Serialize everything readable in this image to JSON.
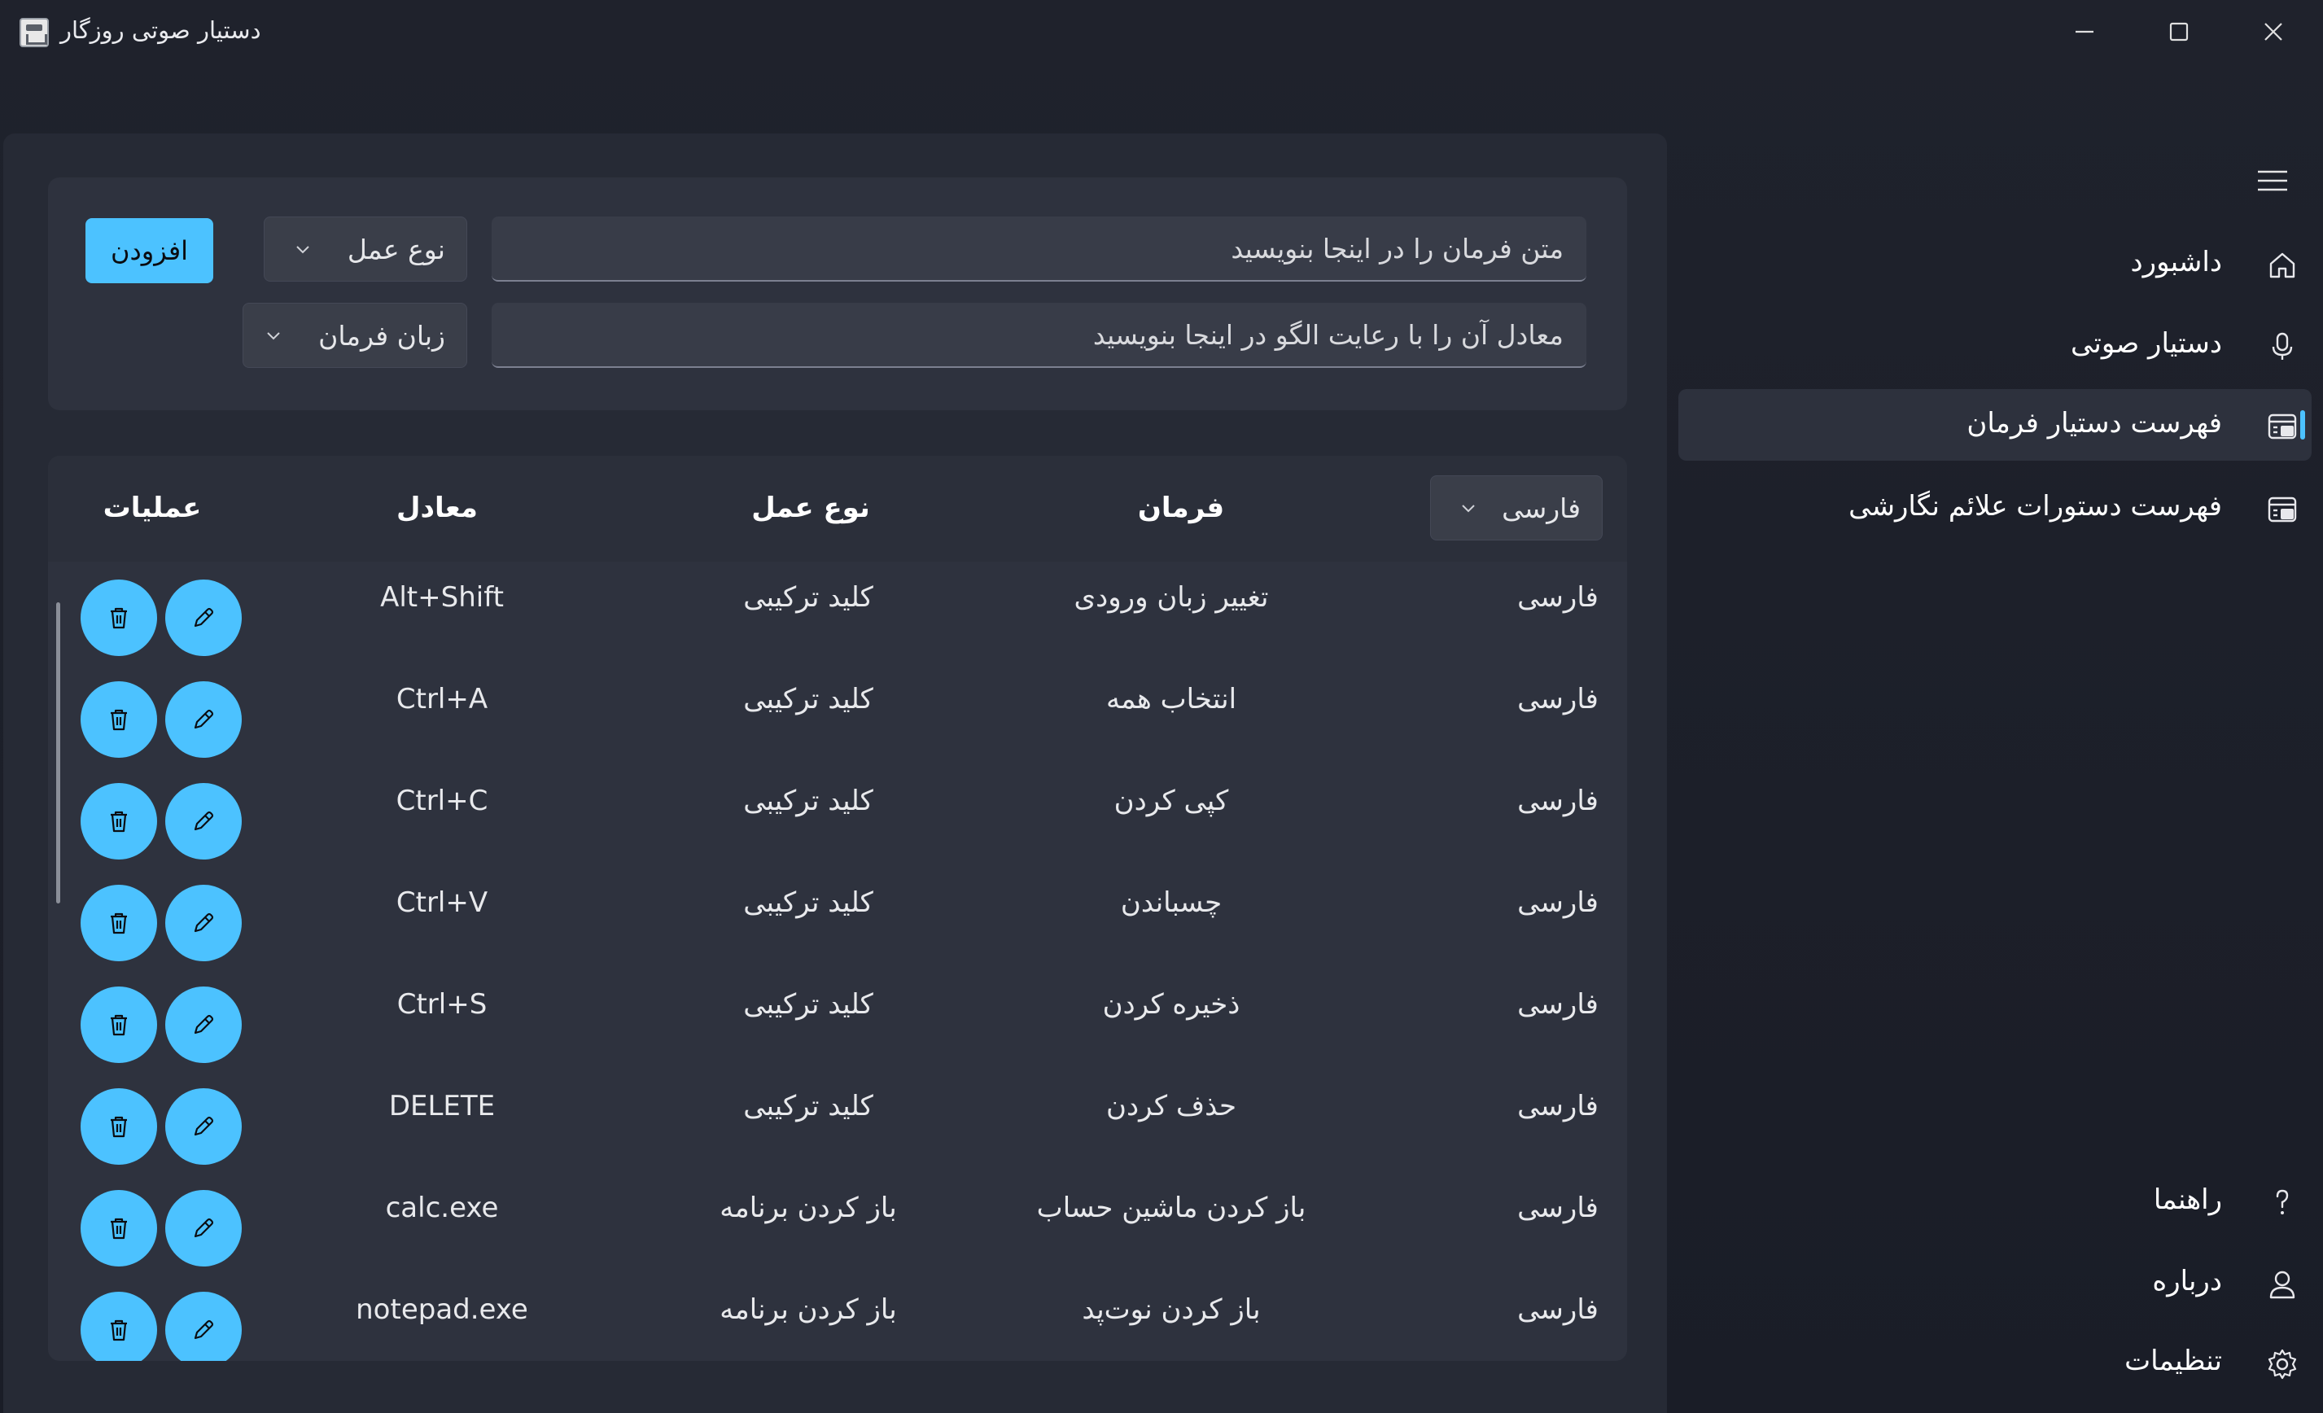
{
  "window": {
    "title": "دستیار صوتی روزگار",
    "accent": "#4cc2ff",
    "icons": {
      "minimize": "minimize-icon",
      "maximize": "maximize-icon",
      "close": "close-icon"
    }
  },
  "form": {
    "command_placeholder": "متن فرمان را در اینجا بنویسید",
    "equivalent_placeholder": "معادل آن را با رعایت الگو در اینجا بنویسید",
    "action_type_label": "نوع عمل",
    "command_language_label": "زبان فرمان",
    "add_label": "افزودن"
  },
  "table": {
    "language_filter": "فارسی",
    "headers": {
      "command": "فرمان",
      "action_type": "نوع عمل",
      "equivalent": "معادل",
      "operations": "عملیات"
    },
    "rows": [
      {
        "language": "فارسی",
        "command": "تغییر زبان ورودی",
        "action_type": "کلید ترکیبی",
        "equivalent": "Alt+Shift"
      },
      {
        "language": "فارسی",
        "command": "انتخاب همه",
        "action_type": "کلید ترکیبی",
        "equivalent": "Ctrl+A"
      },
      {
        "language": "فارسی",
        "command": "کپی کردن",
        "action_type": "کلید ترکیبی",
        "equivalent": "Ctrl+C"
      },
      {
        "language": "فارسی",
        "command": "چسباندن",
        "action_type": "کلید ترکیبی",
        "equivalent": "Ctrl+V"
      },
      {
        "language": "فارسی",
        "command": "ذخیره کردن",
        "action_type": "کلید ترکیبی",
        "equivalent": "Ctrl+S"
      },
      {
        "language": "فارسی",
        "command": "حذف کردن",
        "action_type": "کلید ترکیبی",
        "equivalent": "DELETE"
      },
      {
        "language": "فارسی",
        "command": "باز کردن ماشین حساب",
        "action_type": "باز کردن برنامه",
        "equivalent": "calc.exe"
      },
      {
        "language": "فارسی",
        "command": "باز کردن نوت‌پد",
        "action_type": "باز کردن برنامه",
        "equivalent": "notepad.exe"
      }
    ]
  },
  "sidebar": {
    "items": [
      {
        "label": "داشبورد",
        "icon": "home-icon"
      },
      {
        "label": "دستیار صوتی",
        "icon": "microphone-icon"
      },
      {
        "label": "فهرست دستیار فرمان",
        "icon": "list-icon",
        "active": true
      },
      {
        "label": "فهرست دستورات علائم نگارشی",
        "icon": "list-icon"
      }
    ],
    "footer_items": [
      {
        "label": "راهنما",
        "icon": "help-icon"
      },
      {
        "label": "درباره",
        "icon": "person-icon"
      },
      {
        "label": "تنظیمات",
        "icon": "gear-icon"
      }
    ]
  }
}
